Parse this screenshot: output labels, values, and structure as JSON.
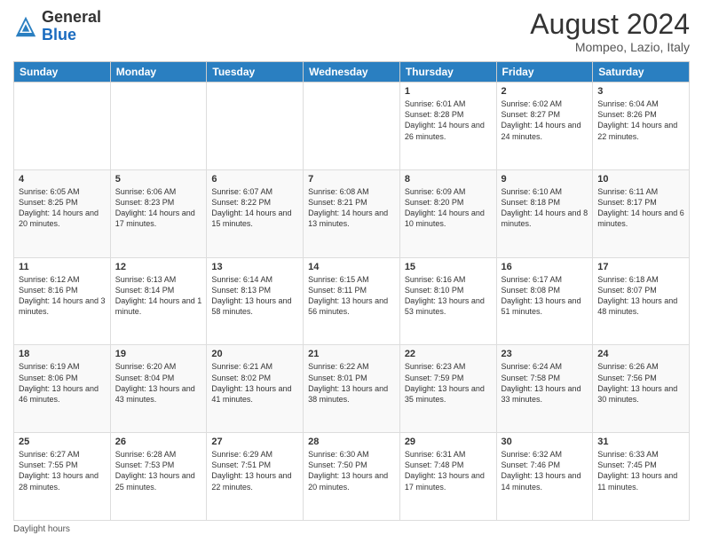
{
  "logo": {
    "general": "General",
    "blue": "Blue"
  },
  "header": {
    "month_year": "August 2024",
    "location": "Mompeo, Lazio, Italy"
  },
  "days_of_week": [
    "Sunday",
    "Monday",
    "Tuesday",
    "Wednesday",
    "Thursday",
    "Friday",
    "Saturday"
  ],
  "weeks": [
    [
      {
        "day": "",
        "info": ""
      },
      {
        "day": "",
        "info": ""
      },
      {
        "day": "",
        "info": ""
      },
      {
        "day": "",
        "info": ""
      },
      {
        "day": "1",
        "info": "Sunrise: 6:01 AM\nSunset: 8:28 PM\nDaylight: 14 hours and 26 minutes."
      },
      {
        "day": "2",
        "info": "Sunrise: 6:02 AM\nSunset: 8:27 PM\nDaylight: 14 hours and 24 minutes."
      },
      {
        "day": "3",
        "info": "Sunrise: 6:04 AM\nSunset: 8:26 PM\nDaylight: 14 hours and 22 minutes."
      }
    ],
    [
      {
        "day": "4",
        "info": "Sunrise: 6:05 AM\nSunset: 8:25 PM\nDaylight: 14 hours and 20 minutes."
      },
      {
        "day": "5",
        "info": "Sunrise: 6:06 AM\nSunset: 8:23 PM\nDaylight: 14 hours and 17 minutes."
      },
      {
        "day": "6",
        "info": "Sunrise: 6:07 AM\nSunset: 8:22 PM\nDaylight: 14 hours and 15 minutes."
      },
      {
        "day": "7",
        "info": "Sunrise: 6:08 AM\nSunset: 8:21 PM\nDaylight: 14 hours and 13 minutes."
      },
      {
        "day": "8",
        "info": "Sunrise: 6:09 AM\nSunset: 8:20 PM\nDaylight: 14 hours and 10 minutes."
      },
      {
        "day": "9",
        "info": "Sunrise: 6:10 AM\nSunset: 8:18 PM\nDaylight: 14 hours and 8 minutes."
      },
      {
        "day": "10",
        "info": "Sunrise: 6:11 AM\nSunset: 8:17 PM\nDaylight: 14 hours and 6 minutes."
      }
    ],
    [
      {
        "day": "11",
        "info": "Sunrise: 6:12 AM\nSunset: 8:16 PM\nDaylight: 14 hours and 3 minutes."
      },
      {
        "day": "12",
        "info": "Sunrise: 6:13 AM\nSunset: 8:14 PM\nDaylight: 14 hours and 1 minute."
      },
      {
        "day": "13",
        "info": "Sunrise: 6:14 AM\nSunset: 8:13 PM\nDaylight: 13 hours and 58 minutes."
      },
      {
        "day": "14",
        "info": "Sunrise: 6:15 AM\nSunset: 8:11 PM\nDaylight: 13 hours and 56 minutes."
      },
      {
        "day": "15",
        "info": "Sunrise: 6:16 AM\nSunset: 8:10 PM\nDaylight: 13 hours and 53 minutes."
      },
      {
        "day": "16",
        "info": "Sunrise: 6:17 AM\nSunset: 8:08 PM\nDaylight: 13 hours and 51 minutes."
      },
      {
        "day": "17",
        "info": "Sunrise: 6:18 AM\nSunset: 8:07 PM\nDaylight: 13 hours and 48 minutes."
      }
    ],
    [
      {
        "day": "18",
        "info": "Sunrise: 6:19 AM\nSunset: 8:06 PM\nDaylight: 13 hours and 46 minutes."
      },
      {
        "day": "19",
        "info": "Sunrise: 6:20 AM\nSunset: 8:04 PM\nDaylight: 13 hours and 43 minutes."
      },
      {
        "day": "20",
        "info": "Sunrise: 6:21 AM\nSunset: 8:02 PM\nDaylight: 13 hours and 41 minutes."
      },
      {
        "day": "21",
        "info": "Sunrise: 6:22 AM\nSunset: 8:01 PM\nDaylight: 13 hours and 38 minutes."
      },
      {
        "day": "22",
        "info": "Sunrise: 6:23 AM\nSunset: 7:59 PM\nDaylight: 13 hours and 35 minutes."
      },
      {
        "day": "23",
        "info": "Sunrise: 6:24 AM\nSunset: 7:58 PM\nDaylight: 13 hours and 33 minutes."
      },
      {
        "day": "24",
        "info": "Sunrise: 6:26 AM\nSunset: 7:56 PM\nDaylight: 13 hours and 30 minutes."
      }
    ],
    [
      {
        "day": "25",
        "info": "Sunrise: 6:27 AM\nSunset: 7:55 PM\nDaylight: 13 hours and 28 minutes."
      },
      {
        "day": "26",
        "info": "Sunrise: 6:28 AM\nSunset: 7:53 PM\nDaylight: 13 hours and 25 minutes."
      },
      {
        "day": "27",
        "info": "Sunrise: 6:29 AM\nSunset: 7:51 PM\nDaylight: 13 hours and 22 minutes."
      },
      {
        "day": "28",
        "info": "Sunrise: 6:30 AM\nSunset: 7:50 PM\nDaylight: 13 hours and 20 minutes."
      },
      {
        "day": "29",
        "info": "Sunrise: 6:31 AM\nSunset: 7:48 PM\nDaylight: 13 hours and 17 minutes."
      },
      {
        "day": "30",
        "info": "Sunrise: 6:32 AM\nSunset: 7:46 PM\nDaylight: 13 hours and 14 minutes."
      },
      {
        "day": "31",
        "info": "Sunrise: 6:33 AM\nSunset: 7:45 PM\nDaylight: 13 hours and 11 minutes."
      }
    ]
  ],
  "footer": {
    "daylight_hours": "Daylight hours"
  }
}
